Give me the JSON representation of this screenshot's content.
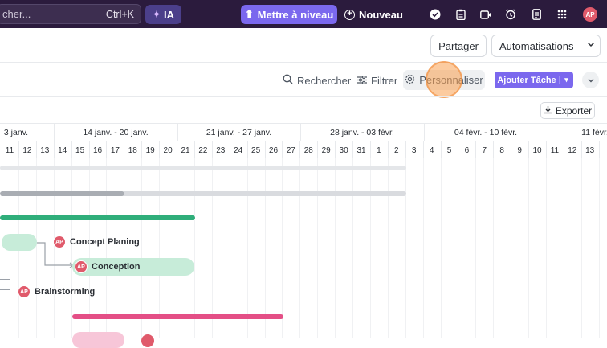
{
  "topbar": {
    "search_placeholder": "cher...",
    "search_shortcut": "Ctrl+K",
    "ia_label": "IA",
    "upgrade_label": "Mettre à niveau",
    "new_label": "Nouveau",
    "avatar_initials": "AP"
  },
  "header": {
    "share_label": "Partager",
    "automations_label": "Automatisations"
  },
  "toolbar": {
    "search_label": "Rechercher",
    "filter_label": "Filtrer",
    "customize_label": "Personnaliser",
    "add_task_label": "Ajouter Tâche",
    "export_label": "Exporter"
  },
  "timeline": {
    "weeks": [
      "3 janv.",
      "14 janv. - 20 janv.",
      "21 janv. - 27 janv.",
      "28 janv. - 03 févr.",
      "04 févr. - 10 févr.",
      "11 févr."
    ],
    "days": [
      "11",
      "12",
      "13",
      "14",
      "15",
      "16",
      "17",
      "18",
      "19",
      "20",
      "21",
      "22",
      "23",
      "24",
      "25",
      "26",
      "27",
      "28",
      "29",
      "30",
      "31",
      "1",
      "2",
      "3",
      "4",
      "5",
      "6",
      "7",
      "8",
      "9",
      "10",
      "11",
      "12",
      "13"
    ]
  },
  "tasks": {
    "concept_planing": "Concept Planing",
    "conception": "Conception",
    "brainstorming": "Brainstorming",
    "assignee": "AP"
  },
  "colors": {
    "topbar": "#2b1b3d",
    "accent": "#7b68ee",
    "green_bar": "#2fae7a",
    "green_pill": "#c7ecd9",
    "pink_bar": "#e44f86",
    "pink_pill": "#f7c6d8"
  }
}
